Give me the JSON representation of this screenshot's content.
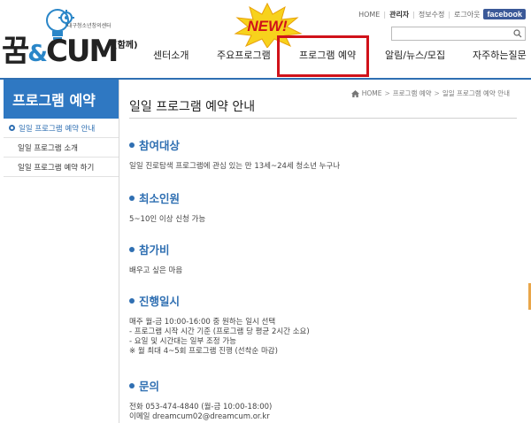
{
  "logo": {
    "main": "꿈",
    "amp": "&",
    "cum": "CUM",
    "tag": "(함께)",
    "sub": "대구청소년창의센터"
  },
  "top_links": {
    "home": "HOME",
    "admin": "관리자",
    "profile": "정보수정",
    "logout": "로그아웃",
    "facebook": "facebook"
  },
  "search": {
    "placeholder": "",
    "value": ""
  },
  "gnb": {
    "new_badge": "NEW!",
    "items": [
      "센터소개",
      "주요프로그램",
      "프로그램 예약",
      "알림/뉴스/모집",
      "자주하는질문"
    ]
  },
  "sidebar": {
    "title": "프로그램 예약",
    "items": [
      "일일 프로그램 예약 안내",
      "일일 프로그램 소개",
      "일일 프로그램 예약 하기"
    ]
  },
  "breadcrumb": {
    "home": "HOME",
    "level1": "프로그램 예약",
    "level2": "일일 프로그램 예약 안내"
  },
  "page_title": "일일 프로그램 예약 안내",
  "sections": [
    {
      "title": "참여대상",
      "lines": [
        "일일 진로탐색 프로그램에 관심 있는 만 13세~24세 청소년 누구나"
      ]
    },
    {
      "title": "최소인원",
      "lines": [
        "5~10인 이상 신청 가능"
      ]
    },
    {
      "title": "참가비",
      "lines": [
        "배우고 싶은 마음"
      ]
    },
    {
      "title": "진행일시",
      "lines": [
        "매주 월-금 10:00-16:00 중 원하는 일시 선택",
        "- 프로그램 시작 시간 기준 (프로그램 당 평균 2시간 소요)",
        "- 요일 및 시간대는 일부 조정 가능",
        "※ 월 최대 4~5회 프로그램 진행 (선착순 마감)"
      ]
    },
    {
      "title": "문의",
      "lines": [
        "전화 053-474-4840 (월-금 10:00-18:00)",
        "이메일 dreamcum02@dreamcum.or.kr"
      ]
    }
  ],
  "colors": {
    "accent": "#2f6fb2",
    "sidebar_bg": "#2f78c2",
    "highlight_box": "#d0121a"
  }
}
